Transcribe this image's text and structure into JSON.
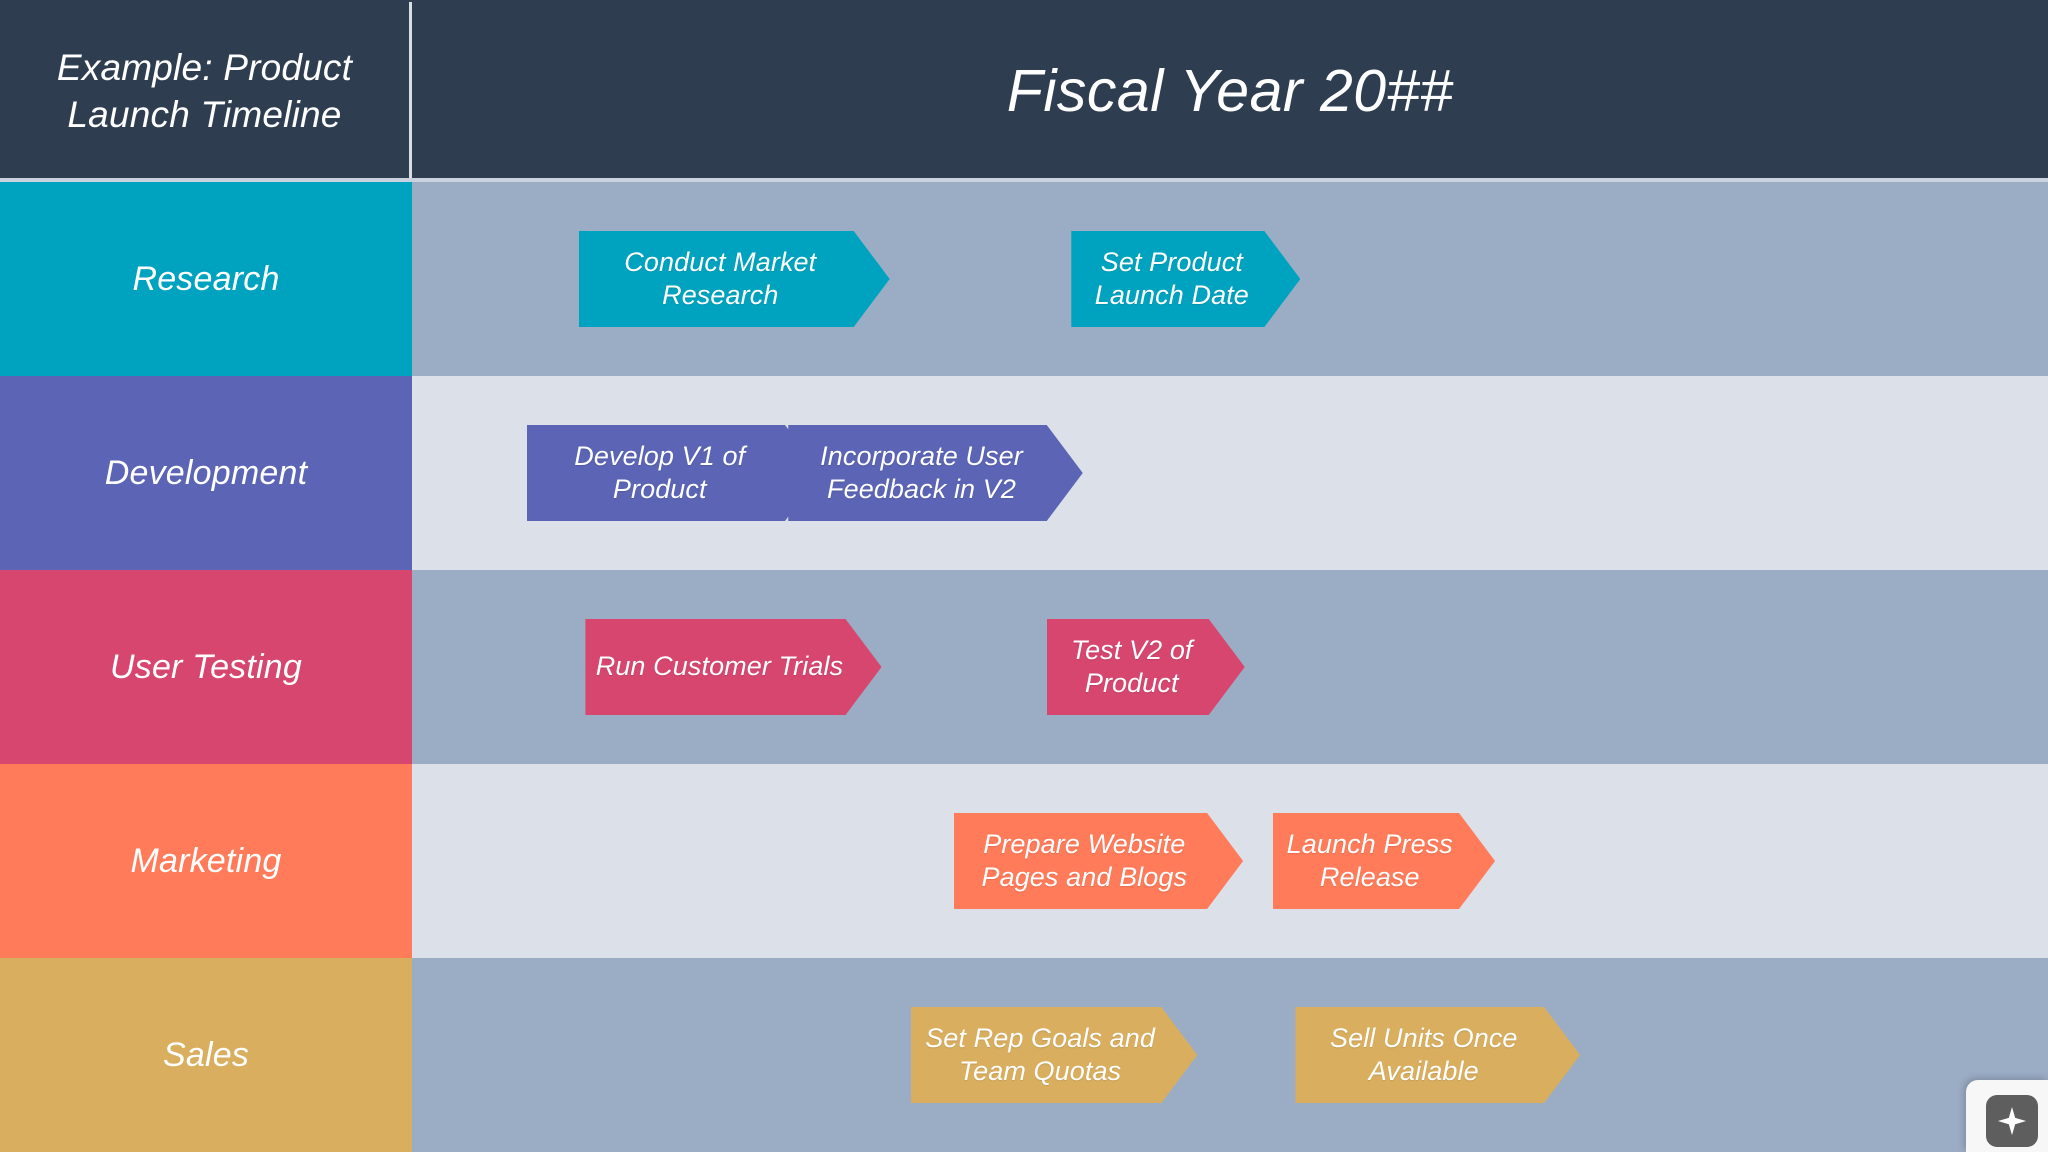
{
  "header": {
    "title": "Example: Product Launch Timeline",
    "period": "Fiscal Year 20##",
    "background_color": "#2E3E50",
    "text_color": "#FFFFFF",
    "divider_color": "#D8DEE6"
  },
  "track_colors": {
    "odd_row": "#9BACC5",
    "even_row": "#DCE0E9"
  },
  "lanes": [
    {
      "label": "Research",
      "color": "#00A3BF",
      "track_color": "#9BACC5",
      "tasks": [
        {
          "label": "Conduct Market Research",
          "color": "#00A3BF",
          "left_pct": 10.2,
          "width_pct": 19.0
        },
        {
          "label": "Set Product Launch Date",
          "color": "#00A3BF",
          "left_pct": 40.3,
          "width_pct": 14.0
        }
      ]
    },
    {
      "label": "Development",
      "color": "#5B64B5",
      "track_color": "#DCE0E9",
      "tasks": [
        {
          "label": "Develop V1 of Product",
          "color": "#5B64B5",
          "left_pct": 7.0,
          "width_pct": 18.0
        },
        {
          "label": "Incorporate User Feedback in V2",
          "color": "#5B64B5",
          "left_pct": 23.0,
          "width_pct": 18.0
        }
      ]
    },
    {
      "label": "User Testing",
      "color": "#D6466F",
      "track_color": "#9BACC5",
      "tasks": [
        {
          "label": "Run Customer Trials",
          "color": "#D6466F",
          "left_pct": 10.6,
          "width_pct": 18.1
        },
        {
          "label": "Test V2 of Product",
          "color": "#D6466F",
          "left_pct": 38.8,
          "width_pct": 12.1
        }
      ]
    },
    {
      "label": "Marketing",
      "color": "#FF7B59",
      "track_color": "#DCE0E9",
      "tasks": [
        {
          "label": "Prepare Website Pages and Blogs",
          "color": "#FF7B59",
          "left_pct": 33.1,
          "width_pct": 17.7
        },
        {
          "label": "Launch Press Release",
          "color": "#FF7B59",
          "left_pct": 52.6,
          "width_pct": 13.6
        }
      ]
    },
    {
      "label": "Sales",
      "color": "#D9AE5F",
      "track_color": "#9BACC5",
      "tasks": [
        {
          "label": "Set Rep Goals and Team Quotas",
          "color": "#D9AE5F",
          "left_pct": 30.5,
          "width_pct": 17.5
        },
        {
          "label": "Sell Units Once Available",
          "color": "#D9AE5F",
          "left_pct": 54.0,
          "width_pct": 17.4
        }
      ]
    }
  ],
  "badge": {
    "icon": "sparkle-icon",
    "card_color": "#F7F7F7",
    "icon_tile_color": "#5E5E5E",
    "icon_color": "#FFFFFF"
  }
}
